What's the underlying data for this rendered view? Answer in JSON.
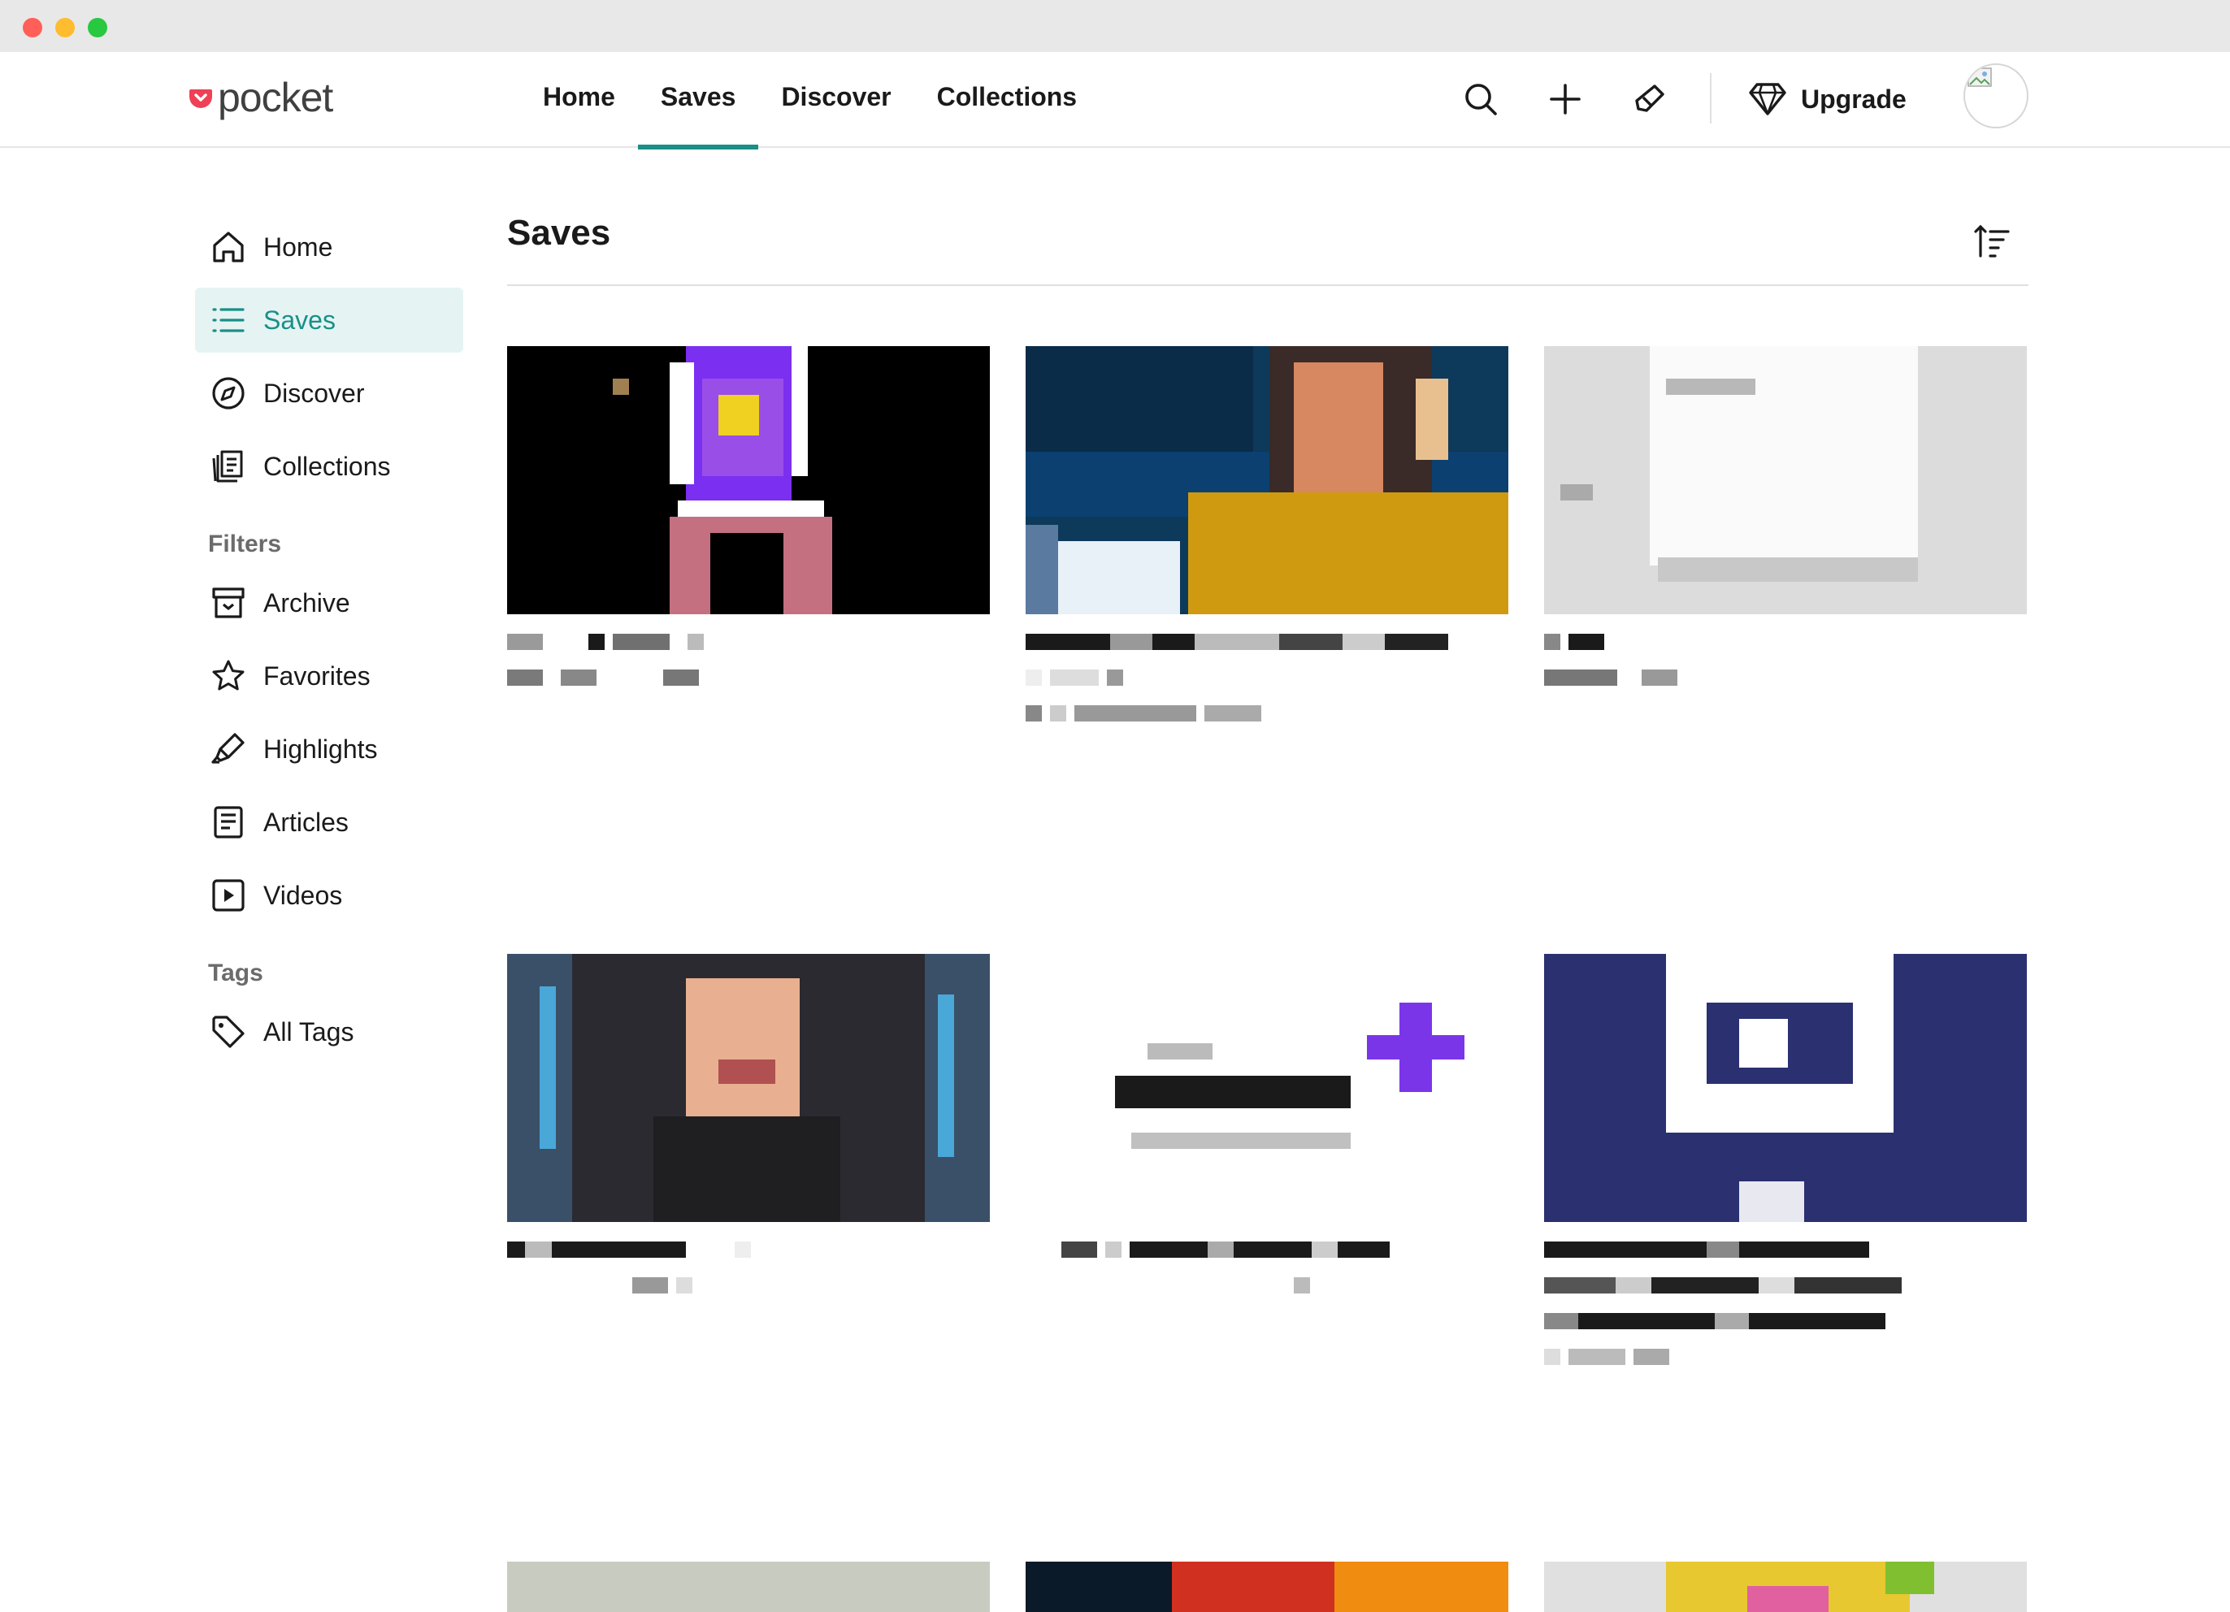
{
  "app": {
    "logo_text": "pocket",
    "brand_color": "#ef4056",
    "accent_color": "#1a8f88"
  },
  "topnav": {
    "items": [
      {
        "label": "Home",
        "active": false
      },
      {
        "label": "Saves",
        "active": true
      },
      {
        "label": "Discover",
        "active": false
      },
      {
        "label": "Collections",
        "active": false
      }
    ],
    "tools": [
      "search-icon",
      "add-icon",
      "highlighter-icon"
    ],
    "upgrade_label": "Upgrade"
  },
  "sidebar": {
    "items": [
      {
        "label": "Home",
        "icon": "home-icon",
        "active": false
      },
      {
        "label": "Saves",
        "icon": "list-icon",
        "active": true
      },
      {
        "label": "Discover",
        "icon": "compass-icon",
        "active": false
      },
      {
        "label": "Collections",
        "icon": "collections-icon",
        "active": false
      }
    ],
    "filters_heading": "Filters",
    "filters": [
      {
        "label": "Archive",
        "icon": "archive-icon"
      },
      {
        "label": "Favorites",
        "icon": "star-icon"
      },
      {
        "label": "Highlights",
        "icon": "highlighter-icon"
      },
      {
        "label": "Articles",
        "icon": "article-icon"
      },
      {
        "label": "Videos",
        "icon": "video-icon"
      }
    ],
    "tags_heading": "Tags",
    "tags": [
      {
        "label": "All Tags",
        "icon": "tag-icon"
      }
    ]
  },
  "main": {
    "title": "Saves",
    "cards": [
      {
        "thumb": "purple-pixel",
        "lines": 2
      },
      {
        "thumb": "woman-yellow",
        "lines": 3
      },
      {
        "thumb": "light-screen",
        "lines": 2
      },
      {
        "thumb": "man-portrait",
        "lines": 2
      },
      {
        "thumb": "white-logo-plus",
        "lines": 2
      },
      {
        "thumb": "navy-logo",
        "lines": 4
      },
      {
        "thumb": "beige",
        "lines": 0
      },
      {
        "thumb": "dark-orange",
        "lines": 0
      },
      {
        "thumb": "colorful",
        "lines": 0
      }
    ]
  }
}
